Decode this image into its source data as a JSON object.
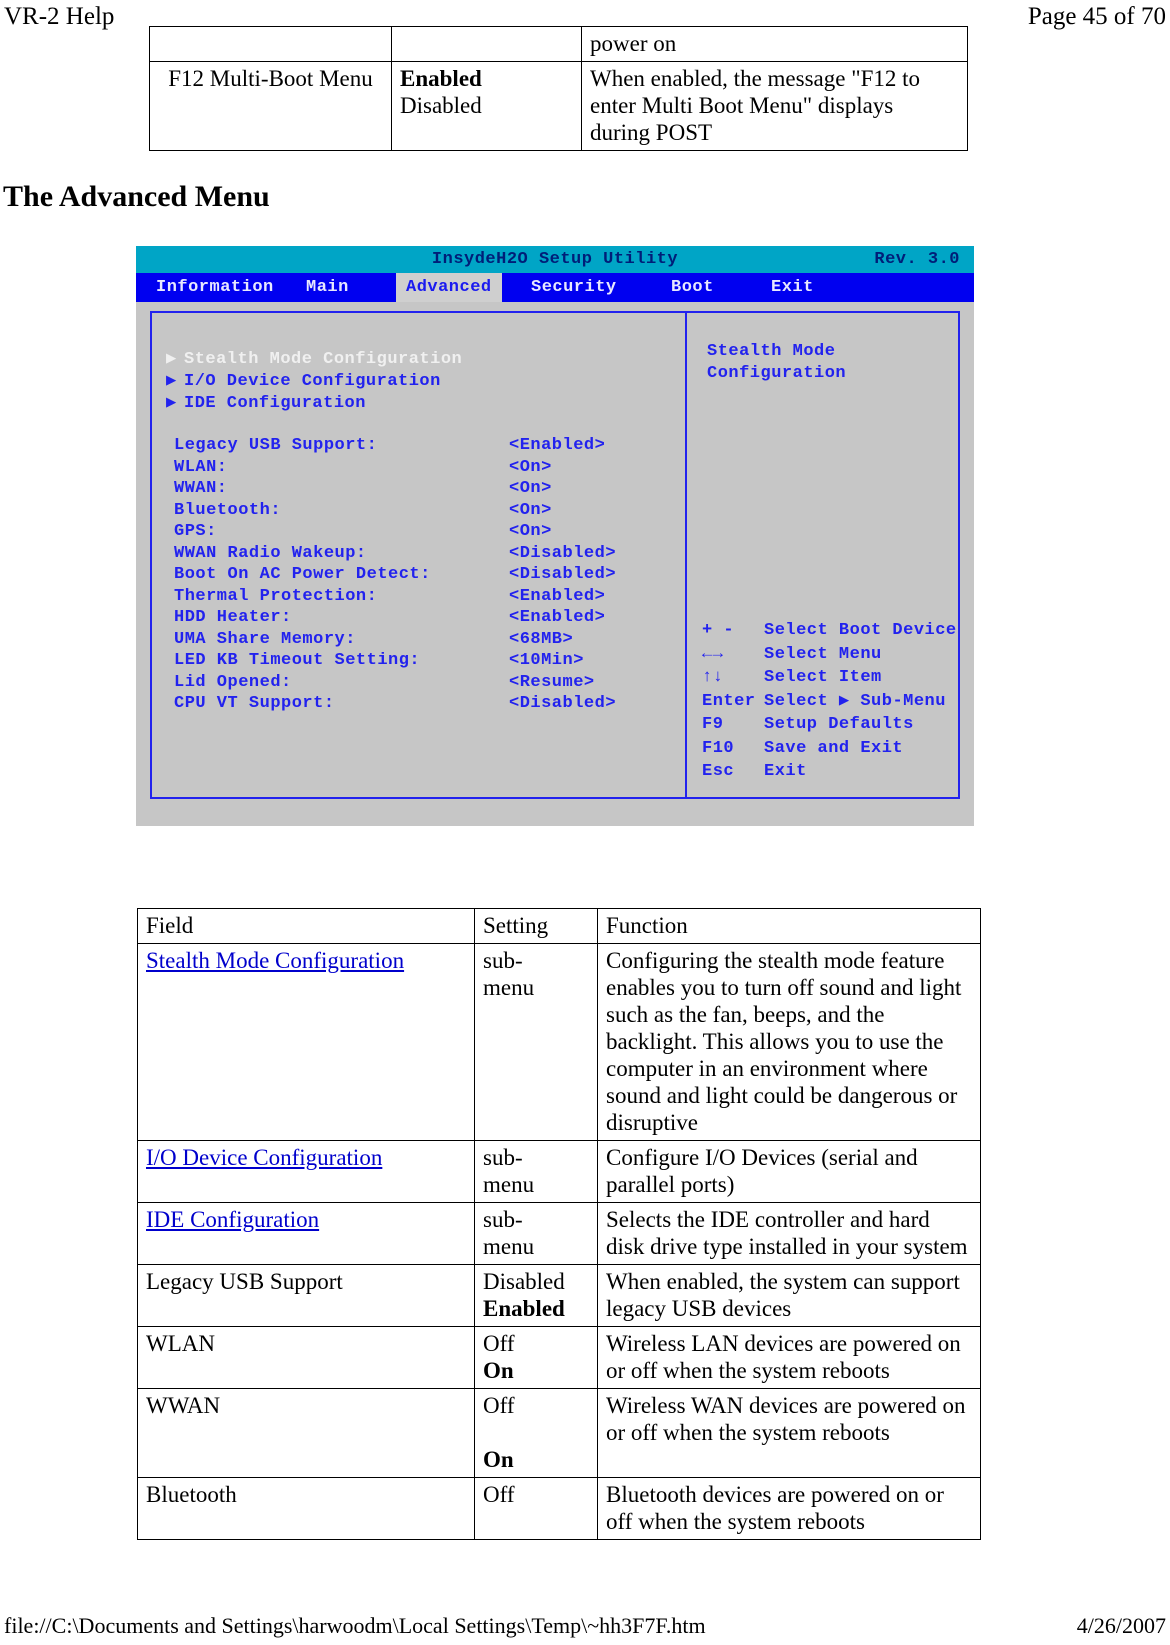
{
  "header": {
    "left": "VR-2 Help",
    "right": "Page 45 of 70"
  },
  "footer": {
    "left": "file://C:\\Documents and Settings\\harwoodm\\Local Settings\\Temp\\~hh3F7F.htm",
    "right": "4/26/2007"
  },
  "section_heading": "The Advanced Menu",
  "top_table": {
    "continued_row": {
      "field": "",
      "setting": "",
      "function": "power on"
    },
    "rows": [
      {
        "field": "F12 Multi-Boot Menu",
        "setting_lines": [
          "Enabled",
          "Disabled"
        ],
        "setting_bold": [
          true,
          false
        ],
        "function": "When enabled, the message \"F12 to enter Multi Boot Menu\" displays during POST"
      }
    ]
  },
  "bios": {
    "title": "InsydeH2O Setup Utility",
    "revision": "Rev. 3.0",
    "tabs": [
      {
        "label": "Information",
        "active": false
      },
      {
        "label": "Main",
        "active": false
      },
      {
        "label": "Advanced",
        "active": true
      },
      {
        "label": "Security",
        "active": false
      },
      {
        "label": "Boot",
        "active": false
      },
      {
        "label": "Exit",
        "active": false
      }
    ],
    "submenus": [
      {
        "label": "Stealth Mode Configuration",
        "selected": true
      },
      {
        "label": "I/O Device Configuration",
        "selected": false
      },
      {
        "label": "IDE Configuration",
        "selected": false
      }
    ],
    "settings": [
      {
        "label": "Legacy USB Support:",
        "value": "<Enabled>"
      },
      {
        "label": "WLAN:",
        "value": "<On>"
      },
      {
        "label": "WWAN:",
        "value": "<On>"
      },
      {
        "label": "Bluetooth:",
        "value": "<On>"
      },
      {
        "label": "GPS:",
        "value": "<On>"
      },
      {
        "label": "WWAN Radio Wakeup:",
        "value": "<Disabled>"
      },
      {
        "label": "Boot On AC Power Detect:",
        "value": "<Disabled>"
      },
      {
        "label": "Thermal Protection:",
        "value": "<Enabled>"
      },
      {
        "label": "HDD Heater:",
        "value": "<Enabled>"
      },
      {
        "label": "UMA Share Memory:",
        "value": "<68MB>"
      },
      {
        "label": "LED KB Timeout Setting:",
        "value": "<10Min>"
      },
      {
        "label": "Lid Opened:",
        "value": "<Resume>"
      },
      {
        "label": "CPU VT Support:",
        "value": "<Disabled>"
      }
    ],
    "help_title_line1": "Stealth Mode",
    "help_title_line2": "Configuration",
    "keys": [
      {
        "key": "+ -",
        "desc": "Select Boot Device"
      },
      {
        "key": "←→",
        "desc": "Select Menu"
      },
      {
        "key": "↑↓",
        "desc": "Select Item"
      },
      {
        "key": "Enter",
        "desc": "Select ▶ Sub-Menu"
      },
      {
        "key": "F9",
        "desc": "Setup Defaults"
      },
      {
        "key": "F10",
        "desc": "Save and Exit"
      },
      {
        "key": "Esc",
        "desc": "Exit"
      }
    ],
    "colors": {
      "titlebar_bg": "#00a5c6",
      "menubar_bg": "#0000f0",
      "panel_bg": "#c6c6c6",
      "text_blue": "#2222ee",
      "active_tab_bg": "#cfcfcf"
    }
  },
  "main_table": {
    "headers": [
      "Field",
      "Setting",
      "Function"
    ],
    "rows": [
      {
        "field": "Stealth Mode Configuration",
        "field_is_link": true,
        "setting_lines": [
          "sub-",
          "menu"
        ],
        "setting_bold": [
          false,
          false
        ],
        "function": "Configuring the stealth mode feature enables you to turn off sound and light such as the fan, beeps, and the backlight. This allows you to use the computer in an environment where sound and light could be dangerous or disruptive"
      },
      {
        "field": "I/O Device Configuration",
        "field_is_link": true,
        "setting_lines": [
          "sub-",
          "menu"
        ],
        "setting_bold": [
          false,
          false
        ],
        "function": "Configure I/O Devices (serial and parallel ports)"
      },
      {
        "field": "IDE Configuration",
        "field_is_link": true,
        "setting_lines": [
          "sub-",
          "menu"
        ],
        "setting_bold": [
          false,
          false
        ],
        "function": "Selects the IDE controller and hard disk drive type installed in your system"
      },
      {
        "field": "Legacy USB Support",
        "field_is_link": false,
        "setting_lines": [
          "Disabled",
          "Enabled"
        ],
        "setting_bold": [
          false,
          true
        ],
        "function": "When enabled, the system can support legacy USB devices"
      },
      {
        "field": "WLAN",
        "field_is_link": false,
        "setting_lines": [
          "Off",
          "On"
        ],
        "setting_bold": [
          false,
          true
        ],
        "function": "Wireless LAN devices are powered on or off when the system reboots"
      },
      {
        "field": "WWAN",
        "field_is_link": false,
        "setting_lines": [
          "Off",
          "",
          "On"
        ],
        "setting_bold": [
          false,
          false,
          true
        ],
        "function": "Wireless WAN devices are powered on or off when the system reboots"
      },
      {
        "field": "Bluetooth",
        "field_is_link": false,
        "setting_lines": [
          "Off"
        ],
        "setting_bold": [
          false
        ],
        "function": "Bluetooth devices are powered on or off when the system reboots"
      }
    ]
  }
}
